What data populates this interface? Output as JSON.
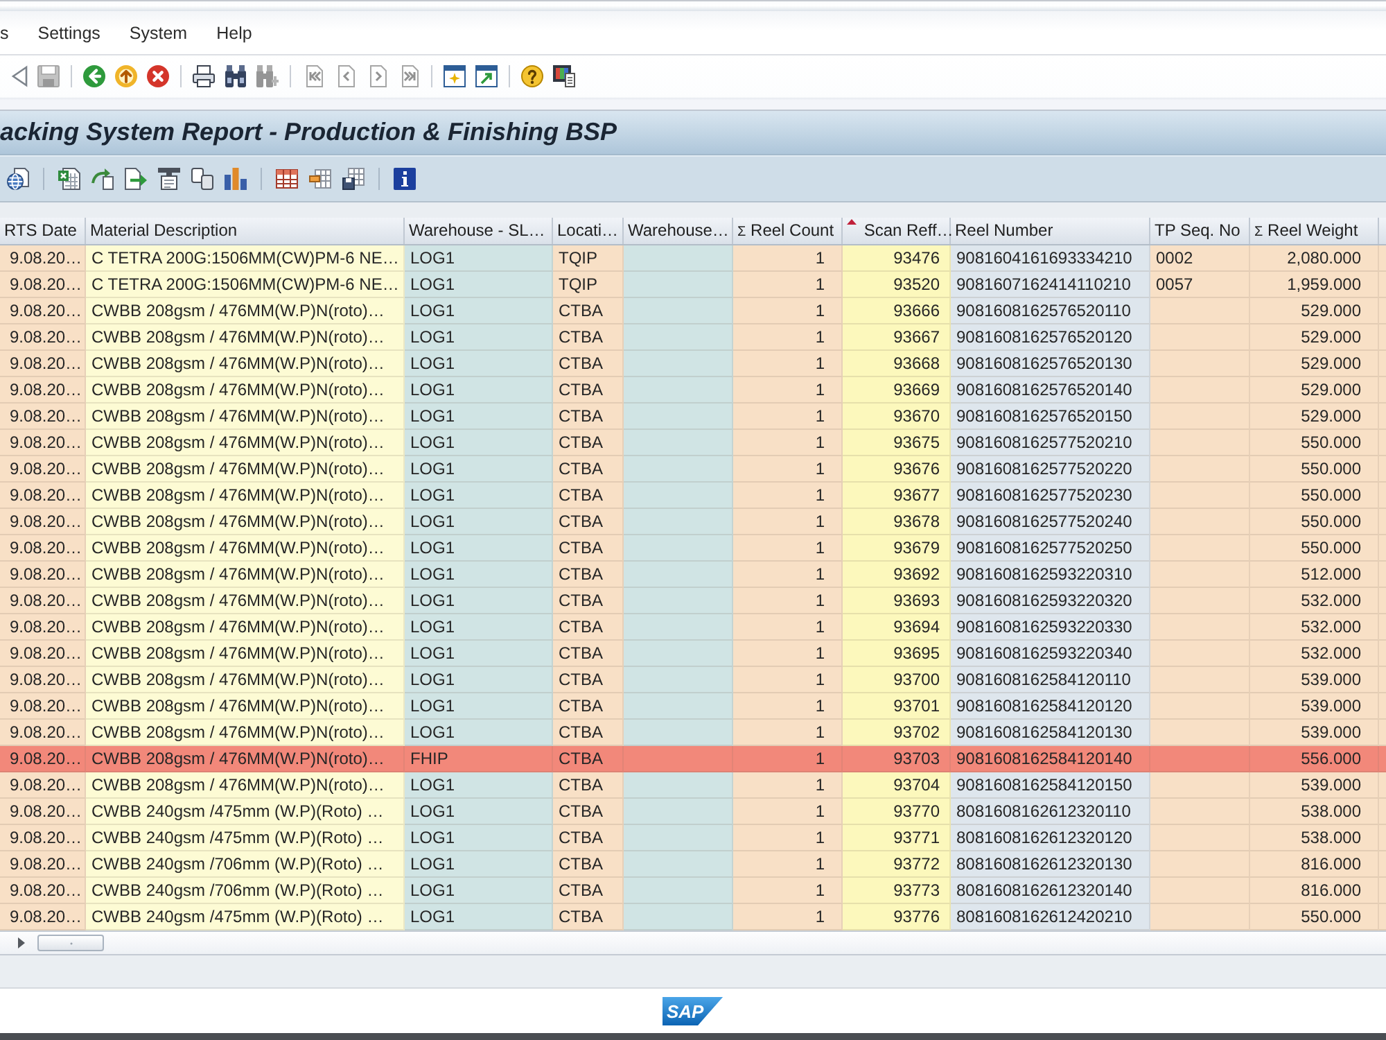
{
  "menu_bar": {
    "items": [
      "s",
      "Settings",
      "System",
      "Help"
    ]
  },
  "toolbar": {
    "groups": [
      [
        {
          "kind": "triangle",
          "disabled": false
        },
        {
          "kind": "save",
          "disabled": true
        }
      ],
      [
        {
          "kind": "back",
          "disabled": false
        },
        {
          "kind": "exit",
          "disabled": false
        },
        {
          "kind": "cancel",
          "disabled": false
        }
      ],
      [
        {
          "kind": "print",
          "disabled": false
        },
        {
          "kind": "find",
          "disabled": false
        },
        {
          "kind": "findnext",
          "disabled": true
        }
      ],
      [
        {
          "kind": "first",
          "disabled": true
        },
        {
          "kind": "previous",
          "disabled": true
        },
        {
          "kind": "next",
          "disabled": true
        },
        {
          "kind": "last",
          "disabled": true
        }
      ],
      [
        {
          "kind": "session",
          "disabled": false
        },
        {
          "kind": "shortcut",
          "disabled": false
        }
      ],
      [
        {
          "kind": "help",
          "disabled": false
        },
        {
          "kind": "layout",
          "disabled": false
        }
      ]
    ]
  },
  "title": "acking System Report - Production & Finishing BSP",
  "app_toolbar": {
    "groups": [
      [
        {
          "kind": "details"
        }
      ],
      [
        {
          "kind": "spreadsheet"
        },
        {
          "kind": "export"
        },
        {
          "kind": "localfile"
        },
        {
          "kind": "form"
        },
        {
          "kind": "cards"
        },
        {
          "kind": "chart"
        }
      ],
      [
        {
          "kind": "grid"
        },
        {
          "kind": "gridtab"
        },
        {
          "kind": "gridsave"
        }
      ],
      [
        {
          "kind": "info"
        }
      ]
    ]
  },
  "table": {
    "columns": [
      {
        "label": "RTS Date",
        "sorted": false,
        "color": "#f8e0c6"
      },
      {
        "label": "Material Description",
        "sorted": false,
        "color": "#fdfbd4"
      },
      {
        "label": "Warehouse - SL…",
        "sorted": false,
        "color": "#d0e4e4"
      },
      {
        "label": "Locati…",
        "sorted": false,
        "color": "#f8e0c6"
      },
      {
        "label": "Warehouse…",
        "sorted": false,
        "color": "#d0e4e4"
      },
      {
        "label": "Reel Count",
        "sum_sign": "Σ",
        "sorted": false,
        "color": "#f8e0c6"
      },
      {
        "label": "Scan Reff…",
        "sorted": true,
        "color": "#fcf8bc"
      },
      {
        "label": "Reel Number",
        "sorted": false,
        "color": "#dee6ed"
      },
      {
        "label": "TP Seq. No",
        "sorted": false,
        "color": "#f8e0c6"
      },
      {
        "label": "Reel Weight",
        "sum_sign": "Σ",
        "sorted": false,
        "color": "#f8e0c6"
      }
    ],
    "rows": [
      {
        "rts_date": "9.08.20…",
        "material_description": "C TETRA 200G:1506MM(CW)PM-6 NE…",
        "warehouse_sl": "LOG1",
        "location": "TQIP",
        "reel_count": "1",
        "scan_reff": "93476",
        "reel_number": "9081604161693334210",
        "tp_seq_no": "0002",
        "reel_weight": "2,080.000",
        "highlighted": false
      },
      {
        "rts_date": "9.08.20…",
        "material_description": "C TETRA 200G:1506MM(CW)PM-6 NE…",
        "warehouse_sl": "LOG1",
        "location": "TQIP",
        "reel_count": "1",
        "scan_reff": "93520",
        "reel_number": "9081607162414110210",
        "tp_seq_no": "0057",
        "reel_weight": "1,959.000",
        "highlighted": false
      },
      {
        "rts_date": "9.08.20…",
        "material_description": "CWBB 208gsm / 476MM(W.P)N(roto)…",
        "warehouse_sl": "LOG1",
        "location": "CTBA",
        "reel_count": "1",
        "scan_reff": "93666",
        "reel_number": "9081608162576520110",
        "reel_weight": "529.000",
        "highlighted": false
      },
      {
        "rts_date": "9.08.20…",
        "material_description": "CWBB 208gsm / 476MM(W.P)N(roto)…",
        "warehouse_sl": "LOG1",
        "location": "CTBA",
        "reel_count": "1",
        "scan_reff": "93667",
        "reel_number": "9081608162576520120",
        "reel_weight": "529.000",
        "highlighted": false
      },
      {
        "rts_date": "9.08.20…",
        "material_description": "CWBB 208gsm / 476MM(W.P)N(roto)…",
        "warehouse_sl": "LOG1",
        "location": "CTBA",
        "reel_count": "1",
        "scan_reff": "93668",
        "reel_number": "9081608162576520130",
        "reel_weight": "529.000",
        "highlighted": false
      },
      {
        "rts_date": "9.08.20…",
        "material_description": "CWBB 208gsm / 476MM(W.P)N(roto)…",
        "warehouse_sl": "LOG1",
        "location": "CTBA",
        "reel_count": "1",
        "scan_reff": "93669",
        "reel_number": "9081608162576520140",
        "reel_weight": "529.000",
        "highlighted": false
      },
      {
        "rts_date": "9.08.20…",
        "material_description": "CWBB 208gsm / 476MM(W.P)N(roto)…",
        "warehouse_sl": "LOG1",
        "location": "CTBA",
        "reel_count": "1",
        "scan_reff": "93670",
        "reel_number": "9081608162576520150",
        "reel_weight": "529.000",
        "highlighted": false
      },
      {
        "rts_date": "9.08.20…",
        "material_description": "CWBB 208gsm / 476MM(W.P)N(roto)…",
        "warehouse_sl": "LOG1",
        "location": "CTBA",
        "reel_count": "1",
        "scan_reff": "93675",
        "reel_number": "9081608162577520210",
        "reel_weight": "550.000",
        "highlighted": false
      },
      {
        "rts_date": "9.08.20…",
        "material_description": "CWBB 208gsm / 476MM(W.P)N(roto)…",
        "warehouse_sl": "LOG1",
        "location": "CTBA",
        "reel_count": "1",
        "scan_reff": "93676",
        "reel_number": "9081608162577520220",
        "reel_weight": "550.000",
        "highlighted": false
      },
      {
        "rts_date": "9.08.20…",
        "material_description": "CWBB 208gsm / 476MM(W.P)N(roto)…",
        "warehouse_sl": "LOG1",
        "location": "CTBA",
        "reel_count": "1",
        "scan_reff": "93677",
        "reel_number": "9081608162577520230",
        "reel_weight": "550.000",
        "highlighted": false
      },
      {
        "rts_date": "9.08.20…",
        "material_description": "CWBB 208gsm / 476MM(W.P)N(roto)…",
        "warehouse_sl": "LOG1",
        "location": "CTBA",
        "reel_count": "1",
        "scan_reff": "93678",
        "reel_number": "9081608162577520240",
        "reel_weight": "550.000",
        "highlighted": false
      },
      {
        "rts_date": "9.08.20…",
        "material_description": "CWBB 208gsm / 476MM(W.P)N(roto)…",
        "warehouse_sl": "LOG1",
        "location": "CTBA",
        "reel_count": "1",
        "scan_reff": "93679",
        "reel_number": "9081608162577520250",
        "reel_weight": "550.000",
        "highlighted": false
      },
      {
        "rts_date": "9.08.20…",
        "material_description": "CWBB 208gsm / 476MM(W.P)N(roto)…",
        "warehouse_sl": "LOG1",
        "location": "CTBA",
        "reel_count": "1",
        "scan_reff": "93692",
        "reel_number": "9081608162593220310",
        "reel_weight": "512.000",
        "highlighted": false
      },
      {
        "rts_date": "9.08.20…",
        "material_description": "CWBB 208gsm / 476MM(W.P)N(roto)…",
        "warehouse_sl": "LOG1",
        "location": "CTBA",
        "reel_count": "1",
        "scan_reff": "93693",
        "reel_number": "9081608162593220320",
        "reel_weight": "532.000",
        "highlighted": false
      },
      {
        "rts_date": "9.08.20…",
        "material_description": "CWBB 208gsm / 476MM(W.P)N(roto)…",
        "warehouse_sl": "LOG1",
        "location": "CTBA",
        "reel_count": "1",
        "scan_reff": "93694",
        "reel_number": "9081608162593220330",
        "reel_weight": "532.000",
        "highlighted": false
      },
      {
        "rts_date": "9.08.20…",
        "material_description": "CWBB 208gsm / 476MM(W.P)N(roto)…",
        "warehouse_sl": "LOG1",
        "location": "CTBA",
        "reel_count": "1",
        "scan_reff": "93695",
        "reel_number": "9081608162593220340",
        "reel_weight": "532.000",
        "highlighted": false
      },
      {
        "rts_date": "9.08.20…",
        "material_description": "CWBB 208gsm / 476MM(W.P)N(roto)…",
        "warehouse_sl": "LOG1",
        "location": "CTBA",
        "reel_count": "1",
        "scan_reff": "93700",
        "reel_number": "9081608162584120110",
        "reel_weight": "539.000",
        "highlighted": false
      },
      {
        "rts_date": "9.08.20…",
        "material_description": "CWBB 208gsm / 476MM(W.P)N(roto)…",
        "warehouse_sl": "LOG1",
        "location": "CTBA",
        "reel_count": "1",
        "scan_reff": "93701",
        "reel_number": "9081608162584120120",
        "reel_weight": "539.000",
        "highlighted": false
      },
      {
        "rts_date": "9.08.20…",
        "material_description": "CWBB 208gsm / 476MM(W.P)N(roto)…",
        "warehouse_sl": "LOG1",
        "location": "CTBA",
        "reel_count": "1",
        "scan_reff": "93702",
        "reel_number": "9081608162584120130",
        "reel_weight": "539.000",
        "highlighted": false
      },
      {
        "rts_date": "9.08.20…",
        "material_description": "CWBB 208gsm / 476MM(W.P)N(roto)…",
        "warehouse_sl": "FHIP",
        "location": "CTBA",
        "reel_count": "1",
        "scan_reff": "93703",
        "reel_number": "9081608162584120140",
        "reel_weight": "556.000",
        "highlighted": true
      },
      {
        "rts_date": "9.08.20…",
        "material_description": "CWBB 208gsm / 476MM(W.P)N(roto)…",
        "warehouse_sl": "LOG1",
        "location": "CTBA",
        "reel_count": "1",
        "scan_reff": "93704",
        "reel_number": "9081608162584120150",
        "reel_weight": "539.000",
        "highlighted": false
      },
      {
        "rts_date": "9.08.20…",
        "material_description": "CWBB 240gsm /475mm (W.P)(Roto) …",
        "warehouse_sl": "LOG1",
        "location": "CTBA",
        "reel_count": "1",
        "scan_reff": "93770",
        "reel_number": "8081608162612320110",
        "reel_weight": "538.000",
        "highlighted": false
      },
      {
        "rts_date": "9.08.20…",
        "material_description": "CWBB 240gsm /475mm (W.P)(Roto) …",
        "warehouse_sl": "LOG1",
        "location": "CTBA",
        "reel_count": "1",
        "scan_reff": "93771",
        "reel_number": "8081608162612320120",
        "reel_weight": "538.000",
        "highlighted": false
      },
      {
        "rts_date": "9.08.20…",
        "material_description": "CWBB 240gsm /706mm (W.P)(Roto) …",
        "warehouse_sl": "LOG1",
        "location": "CTBA",
        "reel_count": "1",
        "scan_reff": "93772",
        "reel_number": "8081608162612320130",
        "reel_weight": "816.000",
        "highlighted": false
      },
      {
        "rts_date": "9.08.20…",
        "material_description": "CWBB 240gsm /706mm (W.P)(Roto) …",
        "warehouse_sl": "LOG1",
        "location": "CTBA",
        "reel_count": "1",
        "scan_reff": "93773",
        "reel_number": "8081608162612320140",
        "reel_weight": "816.000",
        "highlighted": false
      },
      {
        "rts_date": "9.08.20…",
        "material_description": "CWBB 240gsm /475mm (W.P)(Roto) …",
        "warehouse_sl": "LOG1",
        "location": "CTBA",
        "reel_count": "1",
        "scan_reff": "93776",
        "reel_number": "8081608162612420210",
        "reel_weight": "550.000",
        "highlighted": false
      }
    ]
  },
  "status_bar": {
    "logo": "SAP"
  }
}
